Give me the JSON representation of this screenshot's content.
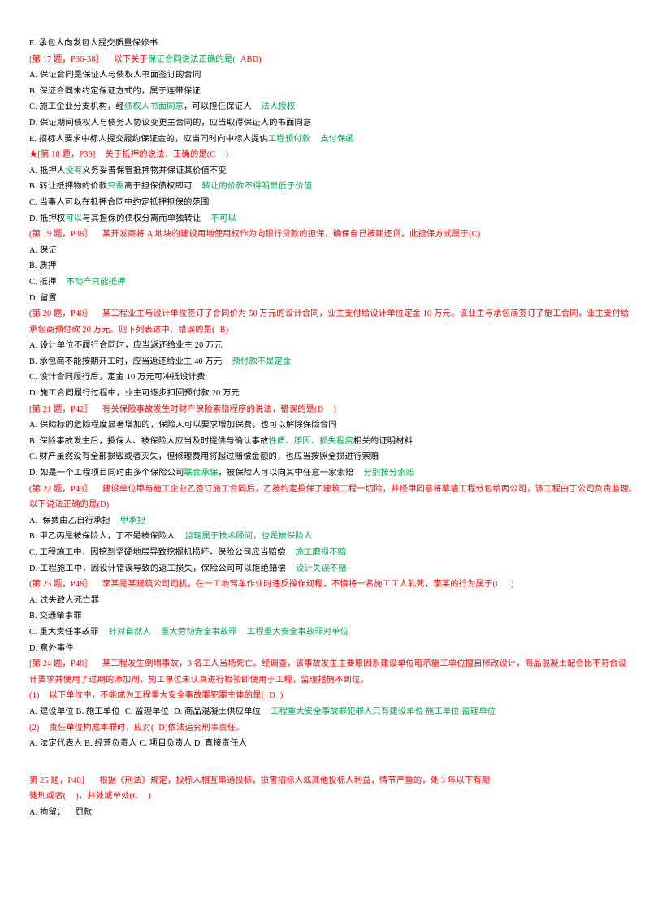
{
  "document": {
    "type": "exam-question-notes",
    "language": "zh-CN",
    "colors": {
      "question_red": "#ff0000",
      "annotation_green": "#00a550",
      "body_black": "#000000",
      "page_background": "#ffffff"
    }
  },
  "lines": [
    {
      "id": "l1",
      "color": "black",
      "segments": [
        {
          "text": "E. 承包人向发包人提交质量保修书",
          "color": "black"
        }
      ]
    },
    {
      "id": "l2",
      "color": "red",
      "segments": [
        {
          "text": "[第 17 题，P36-38］",
          "color": "red"
        },
        {
          "text": "以下关于",
          "color": "red",
          "lead_space": "wide"
        },
        {
          "text": "保证合同说法正确的是(",
          "color": "green"
        },
        {
          "text": "ABD)",
          "color": "red",
          "lead_space": "narrow"
        }
      ]
    },
    {
      "id": "l3",
      "color": "black",
      "segments": [
        {
          "text": "A. 保证合同是保证人与债权人书面签订的合同",
          "color": "black"
        }
      ]
    },
    {
      "id": "l4",
      "color": "black",
      "segments": [
        {
          "text": "B. 保证合同未约定保证方式的，属于连带保证",
          "color": "black"
        }
      ]
    },
    {
      "id": "l5",
      "color": "black",
      "segments": [
        {
          "text": "C. 施工企业分支机构，经",
          "color": "black"
        },
        {
          "text": "债权人书面同意",
          "color": "green"
        },
        {
          "text": "，可以担任保证人",
          "color": "black"
        },
        {
          "text": "法人授权",
          "color": "green",
          "lead_space": "wide"
        }
      ]
    },
    {
      "id": "l6",
      "color": "black",
      "segments": [
        {
          "text": "D. 保证期间债权人与债务人协议变更主合同的，应当取得保证人的书面同意",
          "color": "black"
        }
      ]
    },
    {
      "id": "l7",
      "color": "black",
      "segments": [
        {
          "text": "E. 招标人要求中标人提交履约保证金的，应当同时向中标人提供",
          "color": "black"
        },
        {
          "text": "工程预付款",
          "color": "green"
        },
        {
          "text": "支付保函",
          "color": "green",
          "lead_space": "wide"
        }
      ]
    },
    {
      "id": "l8",
      "color": "red",
      "star": true,
      "segments": [
        {
          "text": "[第 18 题，P39]",
          "color": "red"
        },
        {
          "text": "关于抵押的说法，正确的是(C",
          "color": "red",
          "lead_space": "wide"
        },
        {
          "text": ")",
          "color": "red",
          "lead_space": "wide"
        }
      ]
    },
    {
      "id": "l9",
      "color": "black",
      "segments": [
        {
          "text": "A. 抵押人",
          "color": "black"
        },
        {
          "text": "没有",
          "color": "green"
        },
        {
          "text": "义务妥善保管抵押物并保证其价值不变",
          "color": "black"
        }
      ]
    },
    {
      "id": "l10",
      "color": "black",
      "segments": [
        {
          "text": "B. 转让抵押物的价款",
          "color": "black"
        },
        {
          "text": "只需",
          "color": "green"
        },
        {
          "text": "高于担保债权即可",
          "color": "black"
        },
        {
          "text": "转让的价款不得明显低于价值",
          "color": "green",
          "lead_space": "wide"
        }
      ]
    },
    {
      "id": "l11",
      "color": "black",
      "segments": [
        {
          "text": "C. 当事人可以在抵押合同中约定抵押担保的范围",
          "color": "black"
        }
      ]
    },
    {
      "id": "l12",
      "color": "black",
      "segments": [
        {
          "text": "D. 抵押权",
          "color": "black"
        },
        {
          "text": "可以",
          "color": "green"
        },
        {
          "text": "与其担保的债权分离而单独转让",
          "color": "black"
        },
        {
          "text": "不可以",
          "color": "green",
          "lead_space": "wide"
        }
      ]
    },
    {
      "id": "l13",
      "color": "red",
      "segments": [
        {
          "text": "(第 19 题，P38］",
          "color": "red"
        },
        {
          "text": "某开发商将 A 地块的建设用地使用权作为向银行贷款的担保，确保自己按期还贷，此担保方式属于(C)",
          "color": "red",
          "lead_space": "wide"
        }
      ]
    },
    {
      "id": "l14",
      "color": "black",
      "segments": [
        {
          "text": "A. 保证",
          "color": "black"
        }
      ]
    },
    {
      "id": "l15",
      "color": "black",
      "segments": [
        {
          "text": "B. 质押",
          "color": "black"
        }
      ]
    },
    {
      "id": "l16",
      "color": "black",
      "segments": [
        {
          "text": "C. 抵押",
          "color": "black"
        },
        {
          "text": "不动产只能抵押",
          "color": "green",
          "lead_space": "wide"
        }
      ]
    },
    {
      "id": "l17",
      "color": "black",
      "segments": [
        {
          "text": "D. 留置",
          "color": "black"
        }
      ]
    },
    {
      "id": "l18",
      "color": "red",
      "segments": [
        {
          "text": "(第 20 题，P40］",
          "color": "red"
        },
        {
          "text": "某工程业主与设计单位签订了合同价为 50 万元的设计合同，业主支付给设计单位定金 10 万元。该业主与承包商签订了施工合同，业主支付给",
          "color": "red",
          "lead_space": "wide"
        }
      ]
    },
    {
      "id": "l19",
      "color": "red",
      "segments": [
        {
          "text": "承包商预付款 20 万元。则下列表述中，错误的是(",
          "color": "red"
        },
        {
          "text": "B)",
          "color": "red",
          "lead_space": "narrow"
        }
      ]
    },
    {
      "id": "l20",
      "color": "black",
      "segments": [
        {
          "text": "A. 设计单位不履行合同时，应当返还给业主 20 万元",
          "color": "black"
        }
      ]
    },
    {
      "id": "l21",
      "color": "black",
      "segments": [
        {
          "text": "B. 承包商不能按期开工时，应当返还给业主 40 万元",
          "color": "black"
        },
        {
          "text": "预付款不是定金",
          "color": "green",
          "lead_space": "wide"
        }
      ]
    },
    {
      "id": "l22",
      "color": "black",
      "segments": [
        {
          "text": "C. 设计合同履行后，定金 10 万元可冲抵设计费",
          "color": "black"
        }
      ]
    },
    {
      "id": "l23",
      "color": "black",
      "segments": [
        {
          "text": "D. 施工合同履行过程中，业主可逐步扣回预付款 20 万元",
          "color": "black"
        }
      ]
    },
    {
      "id": "l24",
      "color": "red",
      "segments": [
        {
          "text": "[第 21 题，P42］",
          "color": "red"
        },
        {
          "text": "有关保险事故发生时财产保险索赔程序的说法，错误的是(D",
          "color": "red",
          "lead_space": "wide"
        },
        {
          "text": ")",
          "color": "red",
          "lead_space": "wide"
        }
      ]
    },
    {
      "id": "l25",
      "color": "black",
      "segments": [
        {
          "text": "A. 保险标的危险程度显著增加的，保险人可以要求增加保费，也可以解除保险合同",
          "color": "black"
        }
      ]
    },
    {
      "id": "l26",
      "color": "black",
      "segments": [
        {
          "text": "B. 保险事故发生后，投保人、被保险人应当及时提供与确认事故",
          "color": "black"
        },
        {
          "text": "性质、原因、损失程度",
          "color": "green"
        },
        {
          "text": "相关的证明材料",
          "color": "black"
        }
      ]
    },
    {
      "id": "l27",
      "color": "black",
      "segments": [
        {
          "text": "C. 财产虽然没有全部损毁或者灭失，但修理费用将超过赔偿金额的，也应当按照全损进行索赔",
          "color": "black"
        }
      ]
    },
    {
      "id": "l28",
      "color": "black",
      "segments": [
        {
          "text": "D. 如是一个工程项目同时由多个保险公司",
          "color": "black"
        },
        {
          "text": "联合承保",
          "color": "green",
          "strike": true
        },
        {
          "text": "，被保险人可以向其中任意一家索赔",
          "color": "black"
        },
        {
          "text": "分别按分索赔",
          "color": "green",
          "lead_space": "wide"
        }
      ]
    },
    {
      "id": "l29",
      "color": "red",
      "segments": [
        {
          "text": "(第 22 题，P43］",
          "color": "red"
        },
        {
          "text": "建设单位甲与施工企业乙签订施工合同后，乙按约定投保了建筑工程一切险，并经甲同意将幕墙工程分包给丙公司，该工程由丁公司负责监理。",
          "color": "red",
          "lead_space": "wide"
        }
      ]
    },
    {
      "id": "l30",
      "color": "red",
      "segments": [
        {
          "text": "以下说法正确的是(D)",
          "color": "red"
        }
      ]
    },
    {
      "id": "l31",
      "color": "black",
      "segments": [
        {
          "text": "A.",
          "color": "black"
        },
        {
          "text": "保费由乙自行承担",
          "color": "black",
          "lead_space": "narrow"
        },
        {
          "text": "甲承担",
          "color": "green",
          "strike": true,
          "lead_space": "wide"
        }
      ]
    },
    {
      "id": "l32",
      "color": "black",
      "segments": [
        {
          "text": "B. 甲乙丙是被保险人，丁不是被保险人",
          "color": "black"
        },
        {
          "text": "监理属于技术顾问，也是被保险人",
          "color": "green",
          "lead_space": "wide"
        }
      ]
    },
    {
      "id": "l33",
      "color": "black",
      "segments": [
        {
          "text": "C. 工程施工中，因挖到坚硬地层导致挖掘机损坏，保险公司应当赔偿",
          "color": "black"
        },
        {
          "text": "施工磨损不赔",
          "color": "green",
          "lead_space": "wide"
        }
      ]
    },
    {
      "id": "l34",
      "color": "black",
      "segments": [
        {
          "text": "D. 工程施工中，因设计错误导致的返工损失，保险公司可以拒绝赔偿",
          "color": "black"
        },
        {
          "text": "设计失误不赔",
          "color": "green",
          "lead_space": "wide"
        }
      ]
    },
    {
      "id": "l35",
      "color": "red",
      "segments": [
        {
          "text": "(第 23 题，P48］",
          "color": "red"
        },
        {
          "text": "李某是某建筑公司司机，在一工地驾车作业时违反操作规程，不慎将一名施工工人轧死，李某的行为属于(C",
          "color": "red",
          "lead_space": "wide"
        },
        {
          "text": ")",
          "color": "red",
          "lead_space": "wide"
        }
      ]
    },
    {
      "id": "l36",
      "color": "black",
      "segments": [
        {
          "text": "A. 过失致人死亡罪",
          "color": "black"
        }
      ]
    },
    {
      "id": "l37",
      "color": "black",
      "segments": [
        {
          "text": "B. 交通肇事罪",
          "color": "black"
        }
      ]
    },
    {
      "id": "l38",
      "color": "black",
      "segments": [
        {
          "text": "C. 重大责任事故罪",
          "color": "black"
        },
        {
          "text": "针对自然人",
          "color": "green",
          "lead_space": "wide"
        },
        {
          "text": "重大劳动安全事故罪",
          "color": "green",
          "lead_space": "wide"
        },
        {
          "text": "工程重大安全事故罪对单位",
          "color": "green",
          "lead_space": "wide"
        }
      ]
    },
    {
      "id": "l39",
      "color": "black",
      "segments": [
        {
          "text": "D. 意外事件",
          "color": "black"
        }
      ]
    },
    {
      "id": "l40",
      "color": "red",
      "segments": [
        {
          "text": "[第 24 题，P48］",
          "color": "red"
        },
        {
          "text": "某工程发生倒塌事故，3 名工人当场死亡。经调查，该事故发生主要原因系建设单位暗示施工单位擅自修改设计，商品混凝土配合比不符合设",
          "color": "red",
          "lead_space": "wide"
        }
      ]
    },
    {
      "id": "l41",
      "color": "red",
      "segments": [
        {
          "text": "计要求并使用了过期的添加剂，施工单位未认真进行检验即使用于工程，监理措施不到位。",
          "color": "red"
        }
      ]
    },
    {
      "id": "l42",
      "color": "red",
      "segments": [
        {
          "text": "(1)",
          "color": "red"
        },
        {
          "text": "以下单位中，不能成为工程重大安全事故罪犯罪主体的是(",
          "color": "red",
          "lead_space": "wide"
        },
        {
          "text": "D",
          "color": "red",
          "lead_space": "narrow"
        },
        {
          "text": ")",
          "color": "red",
          "lead_space": "narrow"
        }
      ]
    },
    {
      "id": "l43",
      "color": "black",
      "segments": [
        {
          "text": "A. 建设单位 B. 施工单位",
          "color": "black"
        },
        {
          "text": "C. 监理单位",
          "color": "black",
          "lead_space": "narrow"
        },
        {
          "text": "D. 商品混凝土供应单位",
          "color": "black",
          "lead_space": "narrow"
        },
        {
          "text": "工程重大安全事故罪犯罪人只有建设单位 施工单位 监理单位",
          "color": "green",
          "lead_space": "wide"
        }
      ]
    },
    {
      "id": "l44",
      "color": "red",
      "segments": [
        {
          "text": "(2)",
          "color": "red"
        },
        {
          "text": "责任单位构成本罪时，应对(",
          "color": "red",
          "lead_space": "wide"
        },
        {
          "text": "D)依法追究刑事责任。",
          "color": "red",
          "lead_space": "narrow"
        }
      ]
    },
    {
      "id": "l45",
      "color": "black",
      "segments": [
        {
          "text": "A. 法定代表人 B. 经营负责人 C. 项目负责人 D. 直接责任人",
          "color": "black"
        }
      ]
    },
    {
      "id": "l46",
      "color": "red",
      "spacer_before": "big",
      "segments": [
        {
          "text": "第 25 题，P48］",
          "color": "red"
        },
        {
          "text": "根据《刑法》规定，投标人相互串通投标，损害招标人或其他投标人利益，情节严重的，处 3 年以下有期",
          "color": "red",
          "lead_space": "wide"
        }
      ]
    },
    {
      "id": "l47",
      "color": "red",
      "segments": [
        {
          "text": "徒刑或者(",
          "color": "red"
        },
        {
          "text": ")，并处或单处(C",
          "color": "red",
          "lead_space": "wide"
        },
        {
          "text": ")",
          "color": "red",
          "lead_space": "wide"
        }
      ]
    },
    {
      "id": "l48",
      "color": "black",
      "segments": [
        {
          "text": "A. 拘留；",
          "color": "black"
        },
        {
          "text": "罚款",
          "color": "black",
          "lead_space": "wide"
        }
      ]
    }
  ]
}
